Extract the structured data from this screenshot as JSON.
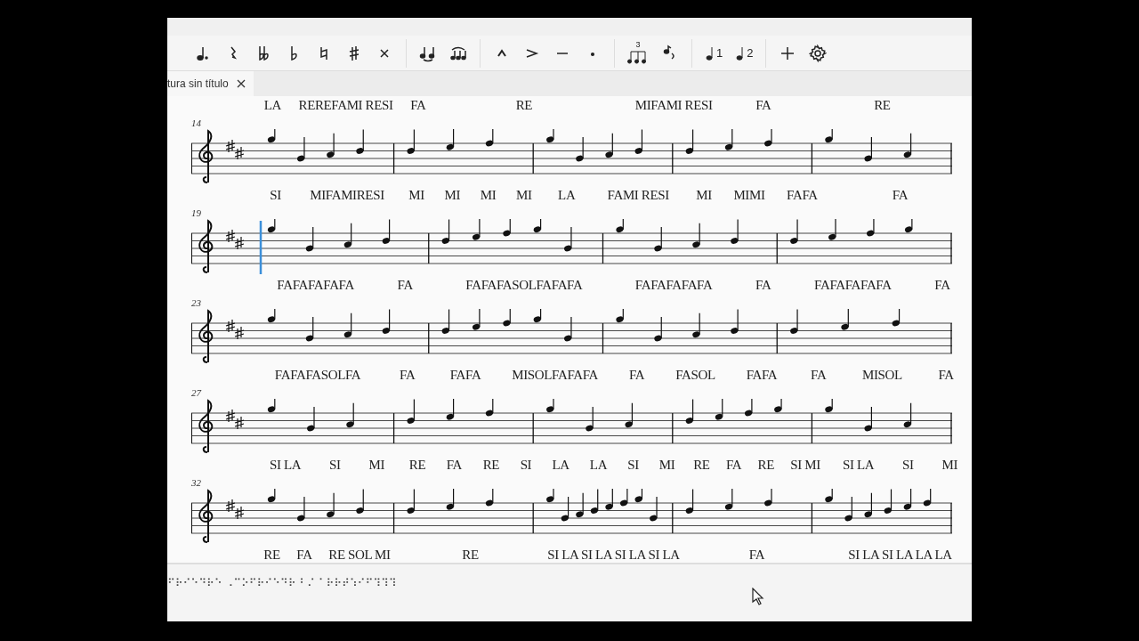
{
  "toolbar": {
    "tuplet_label": "3",
    "voices": [
      "1",
      "2"
    ]
  },
  "tabs": [
    {
      "label": "tura sin título",
      "selected": true
    }
  ],
  "lyrics_top": [
    [
      "LA",
      "REREFAMI RESI",
      "FA"
    ],
    [
      "RE"
    ],
    [
      "MIFAMI RESI",
      "FA"
    ],
    [
      "RE"
    ]
  ],
  "systems": [
    {
      "number": "14",
      "measures": [
        [
          "SI",
          "MIFAMIRESI"
        ],
        [
          "MI",
          "MI",
          "MI",
          "MI"
        ],
        [
          "LA",
          "FAMI RESI"
        ],
        [
          "MI",
          "MIMI",
          "FAFA"
        ],
        [
          "FA"
        ]
      ]
    },
    {
      "number": "19",
      "measures": [
        [
          "FAFAFAFAFA",
          "FA"
        ],
        [
          "FAFAFASOLFAFAFA"
        ],
        [
          "FAFAFAFAFA",
          "FA"
        ],
        [
          "FAFAFAFAFA",
          "FA"
        ]
      ]
    },
    {
      "number": "23",
      "measures": [
        [
          "FAFAFASOLFA",
          "FA"
        ],
        [
          "FAFA",
          "MISOLFAFAFA"
        ],
        [
          "FA",
          "FASOL",
          "FAFA"
        ],
        [
          "FA",
          "MISOL",
          "FA"
        ]
      ]
    },
    {
      "number": "27",
      "measures": [
        [
          "SI LA",
          "SI",
          "MI"
        ],
        [
          "RE",
          "FA",
          "RE",
          "SI"
        ],
        [
          "LA",
          "LA",
          "SI",
          "MI"
        ],
        [
          "RE",
          "FA",
          "RE",
          "SI MI"
        ],
        [
          "SI LA",
          "SI",
          "MI"
        ]
      ]
    },
    {
      "number": "32",
      "measures": [
        [
          "RE",
          "FA",
          "RE SOL MI"
        ],
        [
          "RE"
        ],
        [
          "SI LA SI LA SI LA SI LA"
        ],
        [
          "FA"
        ],
        [
          "SI LA SI LA LA LA"
        ]
      ]
    }
  ],
  "braille": "⠋⠗⠊⠑⠙⠗⠑ ⠠⠉⠕⠋⠗⠊⠑⠙⠗ ⠃⠌ ⠁⠗⠗⠞⠱⠊⠋⠹⠹⠹"
}
